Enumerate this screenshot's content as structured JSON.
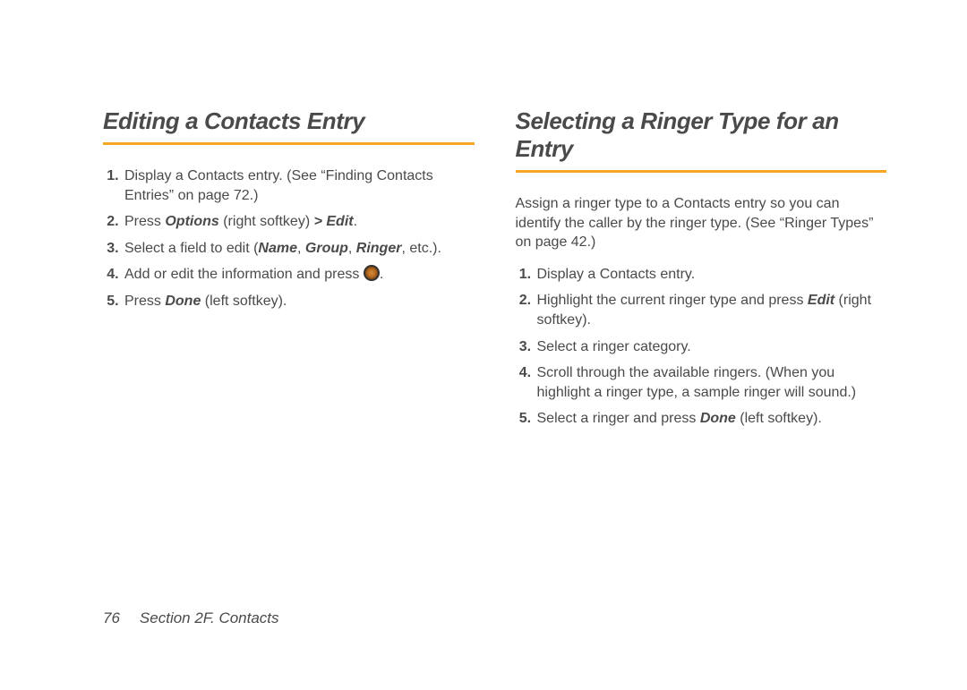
{
  "left": {
    "heading": "Editing a Contacts Entry",
    "step1": "Display a Contacts entry. (See “Finding Contacts Entries” on page 72.)",
    "step2_a": "Press ",
    "step2_b": "Options",
    "step2_c": " (right softkey) ",
    "step2_d": "> Edit",
    "step2_e": ".",
    "step3_a": "Select a field to edit (",
    "step3_b": "Name",
    "step3_c": ", ",
    "step3_d": "Group",
    "step3_e": ", ",
    "step3_f": "Ringer",
    "step3_g": ", etc.).",
    "step4_a": "Add or edit the information and press ",
    "step4_b": ".",
    "step5_a": "Press ",
    "step5_b": "Done",
    "step5_c": " (left softkey)."
  },
  "right": {
    "heading": "Selecting a Ringer Type for an Entry",
    "intro": "Assign a ringer type to a Contacts entry so you can identify the caller by the ringer type. (See “Ringer Types” on page 42.)",
    "step1": "Display a Contacts entry.",
    "step2_a": "Highlight the current ringer type and press ",
    "step2_b": "Edit",
    "step2_c": " (right softkey).",
    "step3": "Select a ringer category.",
    "step4": "Scroll through the available ringers. (When you highlight a ringer type, a sample ringer will sound.)",
    "step5_a": "Select a ringer and press ",
    "step5_b": "Done",
    "step5_c": " (left softkey)."
  },
  "footer": {
    "page_number": "76",
    "section": "Section 2F. Contacts"
  }
}
